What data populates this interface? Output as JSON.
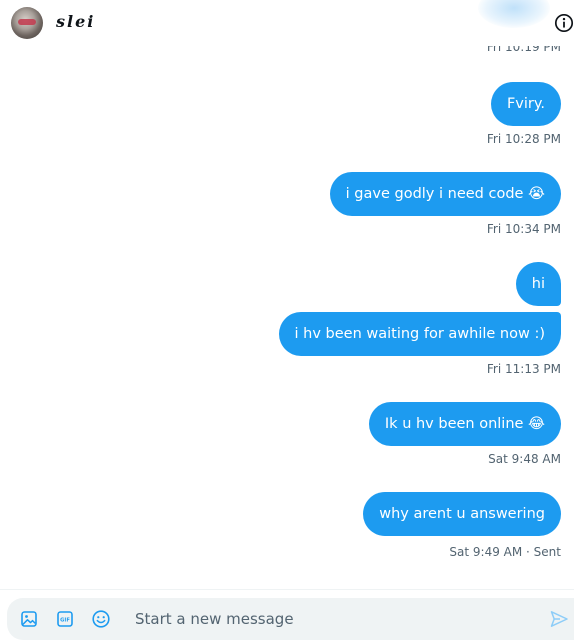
{
  "header": {
    "contact_name": "slei",
    "avatar_icon": "profile-avatar",
    "info_icon": "info-icon"
  },
  "messages": [
    {
      "kind": "timestamp",
      "text": "Fri 10:19 PM"
    },
    {
      "kind": "bubble",
      "text": "Fviry."
    },
    {
      "kind": "timestamp",
      "text": "Fri 10:28 PM"
    },
    {
      "kind": "bubble",
      "text": "i gave godly i need code 😭"
    },
    {
      "kind": "timestamp",
      "text": "Fri 10:34 PM"
    },
    {
      "kind": "bubble",
      "text": "hi"
    },
    {
      "kind": "bubble",
      "text": "i hv been waiting for awhile now :)"
    },
    {
      "kind": "timestamp",
      "text": "Fri 11:13 PM"
    },
    {
      "kind": "bubble",
      "text": "Ik u hv been online 😂"
    },
    {
      "kind": "timestamp",
      "text": "Sat 9:48 AM"
    },
    {
      "kind": "bubble",
      "text": "why arent u answering"
    },
    {
      "kind": "timestamp",
      "text": "Sat 9:49 AM · Sent"
    }
  ],
  "composer": {
    "placeholder": "Start a new message",
    "value": "",
    "media_icon": "image-icon",
    "gif_icon": "gif-icon",
    "gif_label": "GIF",
    "emoji_icon": "emoji-icon",
    "send_icon": "send-icon"
  },
  "colors": {
    "accent": "#1d9bf0",
    "bubble_text": "#ffffff",
    "timestamp_text": "#536471",
    "composer_bg": "#eff3f4"
  }
}
